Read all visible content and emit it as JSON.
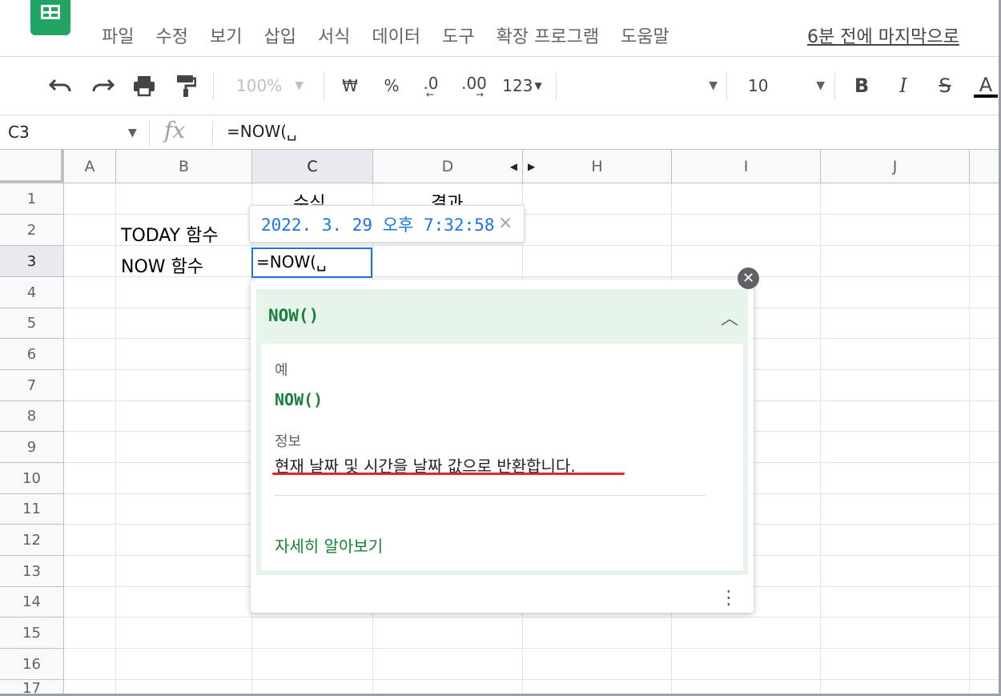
{
  "menu": {
    "items": [
      "파일",
      "수정",
      "보기",
      "삽입",
      "서식",
      "데이터",
      "도구",
      "확장 프로그램",
      "도움말"
    ],
    "last_edit": "6분 전에 마지막으로"
  },
  "toolbar": {
    "zoom": "100%",
    "currency": "₩",
    "percent": "%",
    "decrease_decimal": ".0",
    "increase_decimal": ".00",
    "number_format": "123",
    "font_size": "10",
    "bold": "B",
    "italic": "I",
    "strike": "S",
    "text_color": "A"
  },
  "formula_bar": {
    "name_box": "C3",
    "fx": "fx",
    "formula": "=NOW(␣"
  },
  "columns": [
    "A",
    "B",
    "C",
    "D",
    "H",
    "I",
    "J"
  ],
  "rows": [
    "1",
    "2",
    "3",
    "4",
    "5",
    "6",
    "7",
    "8",
    "9",
    "10",
    "11",
    "12",
    "13",
    "14",
    "15",
    "16",
    "17"
  ],
  "cells": {
    "c1": "수식",
    "d1": "결과",
    "b2": "TODAY 함수",
    "b3": "NOW 함수",
    "c3_edit": "=NOW(␣"
  },
  "tooltip": {
    "value": "2022. 3. 29 오후 7:32:58",
    "close": "×"
  },
  "help": {
    "title": "NOW()",
    "example_label": "예",
    "example_code": "NOW()",
    "info_label": "정보",
    "info_text": "현재 날짜 및 시간을 날짜 값으로 반환합니다.",
    "learn_more": "자세히 알아보기"
  },
  "colors": {
    "brand_green": "#1fa463",
    "help_green": "#188038",
    "selection_blue": "#1a73e8",
    "annotation_red": "#e0242a"
  }
}
